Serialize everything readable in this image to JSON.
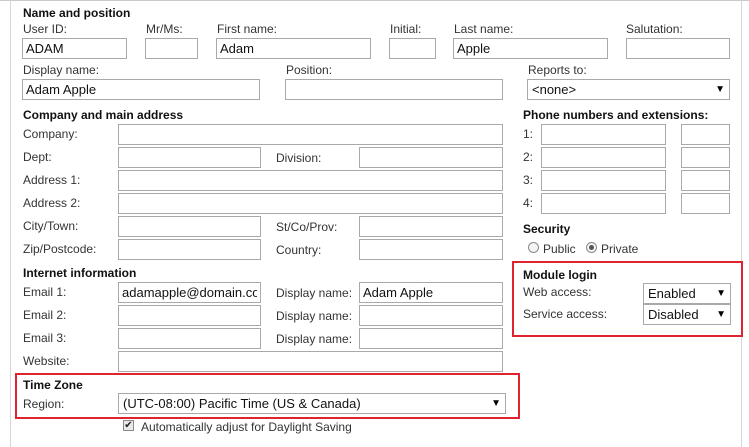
{
  "name_position": {
    "heading": "Name and position",
    "user_id_label": "User ID:",
    "user_id_value": "ADAM",
    "mrms_label": "Mr/Ms:",
    "mrms_value": "",
    "first_name_label": "First name:",
    "first_name_value": "Adam",
    "initial_label": "Initial:",
    "initial_value": "",
    "last_name_label": "Last name:",
    "last_name_value": "Apple",
    "salutation_label": "Salutation:",
    "salutation_value": "",
    "display_name_label": "Display name:",
    "display_name_value": "Adam Apple",
    "position_label": "Position:",
    "position_value": "",
    "reports_to_label": "Reports to:",
    "reports_to_value": "<none>"
  },
  "company": {
    "heading": "Company and main address",
    "company_label": "Company:",
    "dept_label": "Dept:",
    "division_label": "Division:",
    "address1_label": "Address 1:",
    "address2_label": "Address 2:",
    "city_label": "City/Town:",
    "state_label": "St/Co/Prov:",
    "zip_label": "Zip/Postcode:",
    "country_label": "Country:"
  },
  "phones": {
    "heading": "Phone numbers and extensions:",
    "rows": [
      {
        "label": "1:"
      },
      {
        "label": "2:"
      },
      {
        "label": "3:"
      },
      {
        "label": "4:"
      }
    ]
  },
  "security": {
    "heading": "Security",
    "public_label": "Public",
    "private_label": "Private",
    "selected": "Private"
  },
  "module_login": {
    "heading": "Module login",
    "web_access_label": "Web access:",
    "web_access_value": "Enabled",
    "service_access_label": "Service access:",
    "service_access_value": "Disabled"
  },
  "internet": {
    "heading": "Internet information",
    "email1_label": "Email 1:",
    "email1_value": "adamapple@domain.co",
    "email2_label": "Email 2:",
    "email3_label": "Email 3:",
    "display_name_label": "Display name:",
    "display_name1_value": "Adam Apple",
    "website_label": "Website:"
  },
  "timezone": {
    "heading": "Time Zone",
    "region_label": "Region:",
    "region_value": "(UTC-08:00) Pacific Time (US & Canada)",
    "dst_label": "Automatically adjust for Daylight Saving",
    "dst_checked": true
  },
  "colors": {
    "highlight": "#e0242f",
    "input_border": "#a9a9a9"
  }
}
